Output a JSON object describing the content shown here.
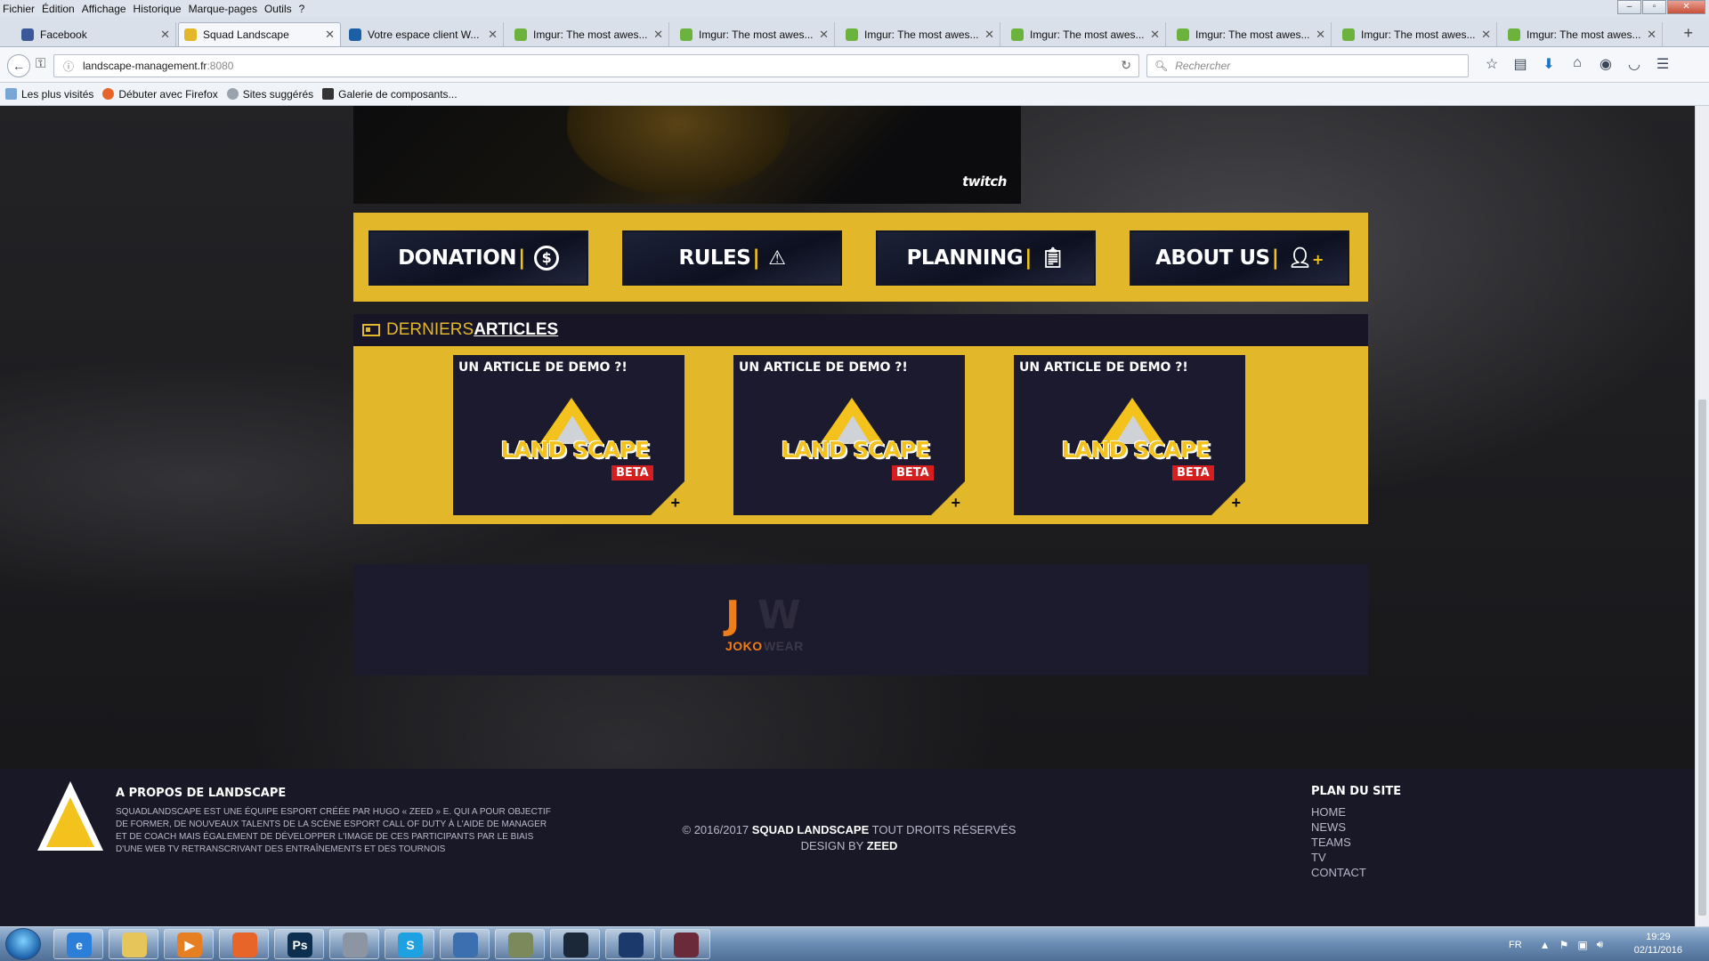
{
  "menubar": {
    "items": [
      "Fichier",
      "Édition",
      "Affichage",
      "Historique",
      "Marque-pages",
      "Outils",
      "?"
    ]
  },
  "tabs": [
    {
      "title": "Facebook",
      "favicon_color": "#3b5998"
    },
    {
      "title": "Squad Landscape",
      "favicon_color": "#e2b82a",
      "active": true
    },
    {
      "title": "Votre espace client W...",
      "favicon_color": "#1c5fa5"
    },
    {
      "title": "Imgur: The most awes...",
      "favicon_color": "#6cb33e"
    },
    {
      "title": "Imgur: The most awes...",
      "favicon_color": "#6cb33e"
    },
    {
      "title": "Imgur: The most awes...",
      "favicon_color": "#6cb33e"
    },
    {
      "title": "Imgur: The most awes...",
      "favicon_color": "#6cb33e"
    },
    {
      "title": "Imgur: The most awes...",
      "favicon_color": "#6cb33e"
    },
    {
      "title": "Imgur: The most awes...",
      "favicon_color": "#6cb33e"
    },
    {
      "title": "Imgur: The most awes...",
      "favicon_color": "#6cb33e"
    }
  ],
  "navbar": {
    "url": "landscape-management.fr",
    "port": ":8080",
    "search_placeholder": "Rechercher"
  },
  "bookmarks": [
    {
      "label": "Les plus visités",
      "icon": "bookmark-folder-icon"
    },
    {
      "label": "Débuter avec Firefox",
      "icon": "firefox-icon"
    },
    {
      "label": "Sites suggérés",
      "icon": "globe-icon"
    },
    {
      "label": "Galerie de composants...",
      "icon": "gallery-icon"
    }
  ],
  "video": {
    "brand": "twitch"
  },
  "quicknav": [
    {
      "label": "DONATION",
      "icon": "dollar-coin-icon"
    },
    {
      "label": "RULES",
      "icon": "warning-icon"
    },
    {
      "label": "PLANNING",
      "icon": "clipboard-icon"
    },
    {
      "label": "ABOUT US",
      "icon": "add-user-icon"
    }
  ],
  "articles": {
    "heading_light": "DERNIERS",
    "heading_bold": "ARTICLES",
    "cards": [
      {
        "title": "UN ARTICLE DE DEMO ?!",
        "logo_text": "LAND SCAPE",
        "badge": "BETA"
      },
      {
        "title": "UN ARTICLE DE DEMO ?!",
        "logo_text": "LAND SCAPE",
        "badge": "BETA"
      },
      {
        "title": "UN ARTICLE DE DEMO ?!",
        "logo_text": "LAND SCAPE",
        "badge": "BETA"
      }
    ]
  },
  "partner": {
    "name_part1": "JOKO",
    "name_part2": "WEAR"
  },
  "footer": {
    "about_title": "A PROPOS DE LANDSCAPE",
    "about_text": "SQUADLANDSCAPE EST UNE ÉQUIPE ESPORT CRÉÉE PAR HUGO « ZEED » E. QUI A POUR OBJECTIF DE FORMER, DE NOUVEAUX TALENTS DE LA SCÈNE ESPORT CALL OF DUTY À L'AIDE DE MANAGER ET DE COACH MAIS ÉGALEMENT DE DÉVELOPPER L'IMAGE DE CES PARTICIPANTS PAR LE BIAIS D'UNE WEB TV RETRANSCRIVANT DES ENTRAÎNEMENTS ET DES TOURNOIS",
    "copyright_prefix": "© 2016/2017",
    "copyright_brand": "SQUAD LANDSCAPE",
    "copyright_suffix": "TOUT DROITS RÉSERVÉS",
    "design_prefix": "DESIGN BY",
    "design_author": "ZEED",
    "sitemap_title": "PLAN DU SITE",
    "sitemap_links": [
      "HOME",
      "NEWS",
      "TEAMS",
      "TV",
      "CONTACT"
    ]
  },
  "taskbar": {
    "apps": [
      {
        "name": "internet-explorer",
        "glyph": "e",
        "color": "#2b7fd8"
      },
      {
        "name": "file-explorer",
        "glyph": "",
        "color": "#e6c55a"
      },
      {
        "name": "media-player",
        "glyph": "▶",
        "color": "#e67e22"
      },
      {
        "name": "firefox",
        "glyph": "",
        "color": "#e8652a"
      },
      {
        "name": "photoshop",
        "glyph": "Ps",
        "color": "#0c2f4f"
      },
      {
        "name": "disc-tool",
        "glyph": "",
        "color": "#8c96a2"
      },
      {
        "name": "skype",
        "glyph": "S",
        "color": "#1da1e0"
      },
      {
        "name": "python",
        "glyph": "",
        "color": "#3b6fb0"
      },
      {
        "name": "file-manager",
        "glyph": "",
        "color": "#7a8a5a"
      },
      {
        "name": "steam",
        "glyph": "",
        "color": "#1b2838"
      },
      {
        "name": "game-launcher",
        "glyph": "",
        "color": "#1b3a6b"
      },
      {
        "name": "game-app",
        "glyph": "",
        "color": "#6b2a3a"
      }
    ],
    "language": "FR",
    "time": "19:29",
    "date": "02/11/2016"
  }
}
